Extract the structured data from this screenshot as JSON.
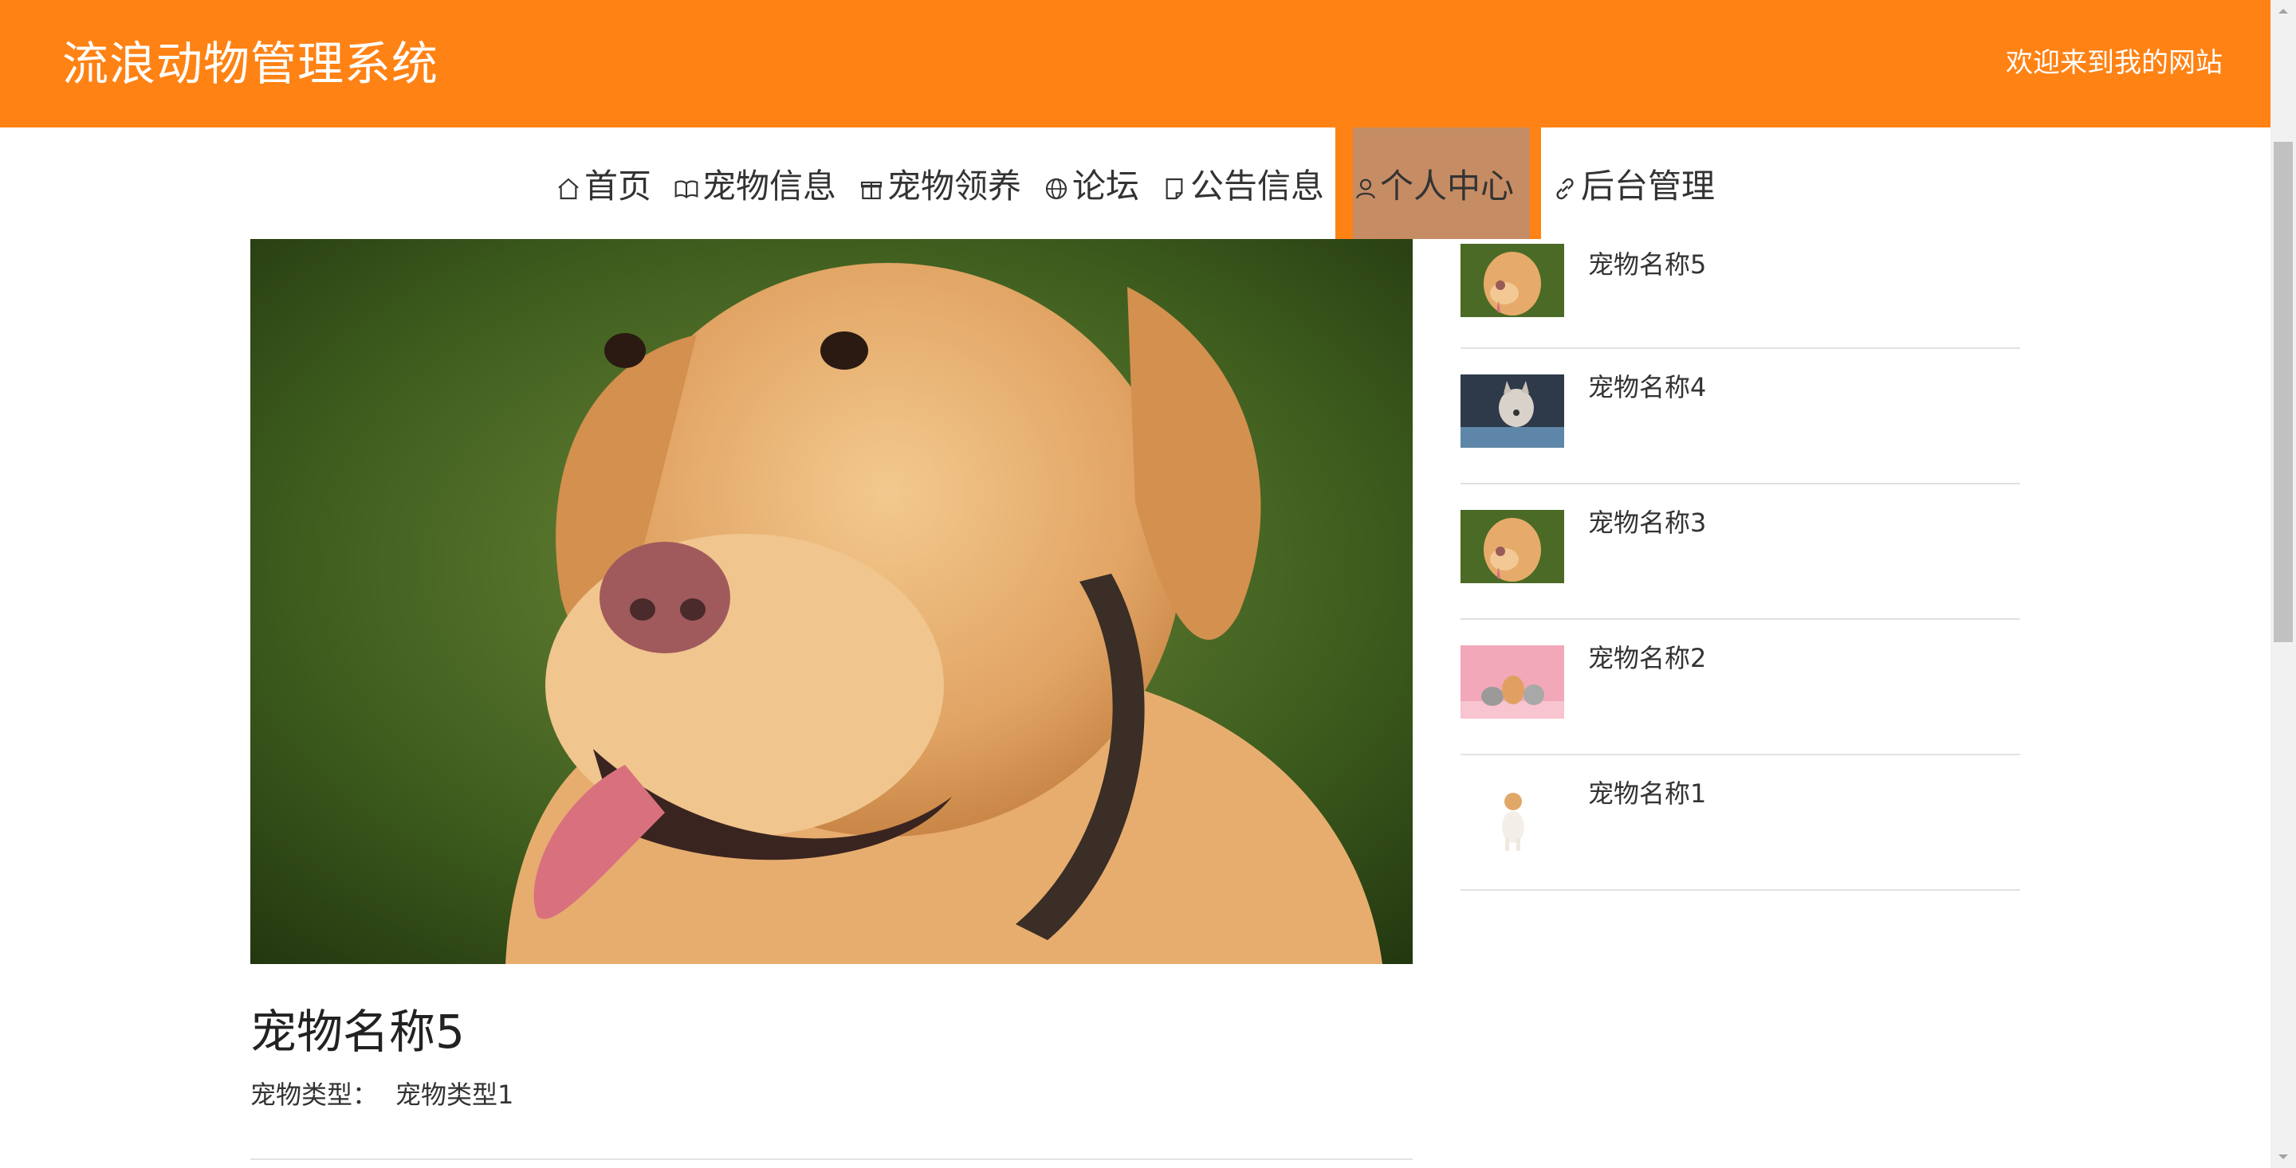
{
  "header": {
    "title": "流浪动物管理系统",
    "welcome": "欢迎来到我的网站",
    "bg_color": "#ff8214"
  },
  "nav": {
    "items": [
      {
        "label": "首页",
        "icon": "home-icon"
      },
      {
        "label": "宠物信息",
        "icon": "book-icon"
      },
      {
        "label": "宠物领养",
        "icon": "gift-icon"
      },
      {
        "label": "论坛",
        "icon": "globe-icon"
      },
      {
        "label": "公告信息",
        "icon": "note-icon"
      },
      {
        "label": "个人中心",
        "icon": "user-icon",
        "active": true
      },
      {
        "label": "后台管理",
        "icon": "link-icon"
      }
    ],
    "active_color": "#c68c64"
  },
  "main": {
    "pet_name": "宠物名称5",
    "type_label": "宠物类型：",
    "type_value": "宠物类型1",
    "image": "golden-retriever-photo"
  },
  "side": {
    "items": [
      {
        "name": "宠物名称5",
        "thumb": "golden-retriever-thumb"
      },
      {
        "name": "宠物名称4",
        "thumb": "husky-thumb"
      },
      {
        "name": "宠物名称3",
        "thumb": "golden-retriever-thumb"
      },
      {
        "name": "宠物名称2",
        "thumb": "pets-pink-thumb"
      },
      {
        "name": "宠物名称1",
        "thumb": "jack-russell-thumb"
      }
    ]
  }
}
